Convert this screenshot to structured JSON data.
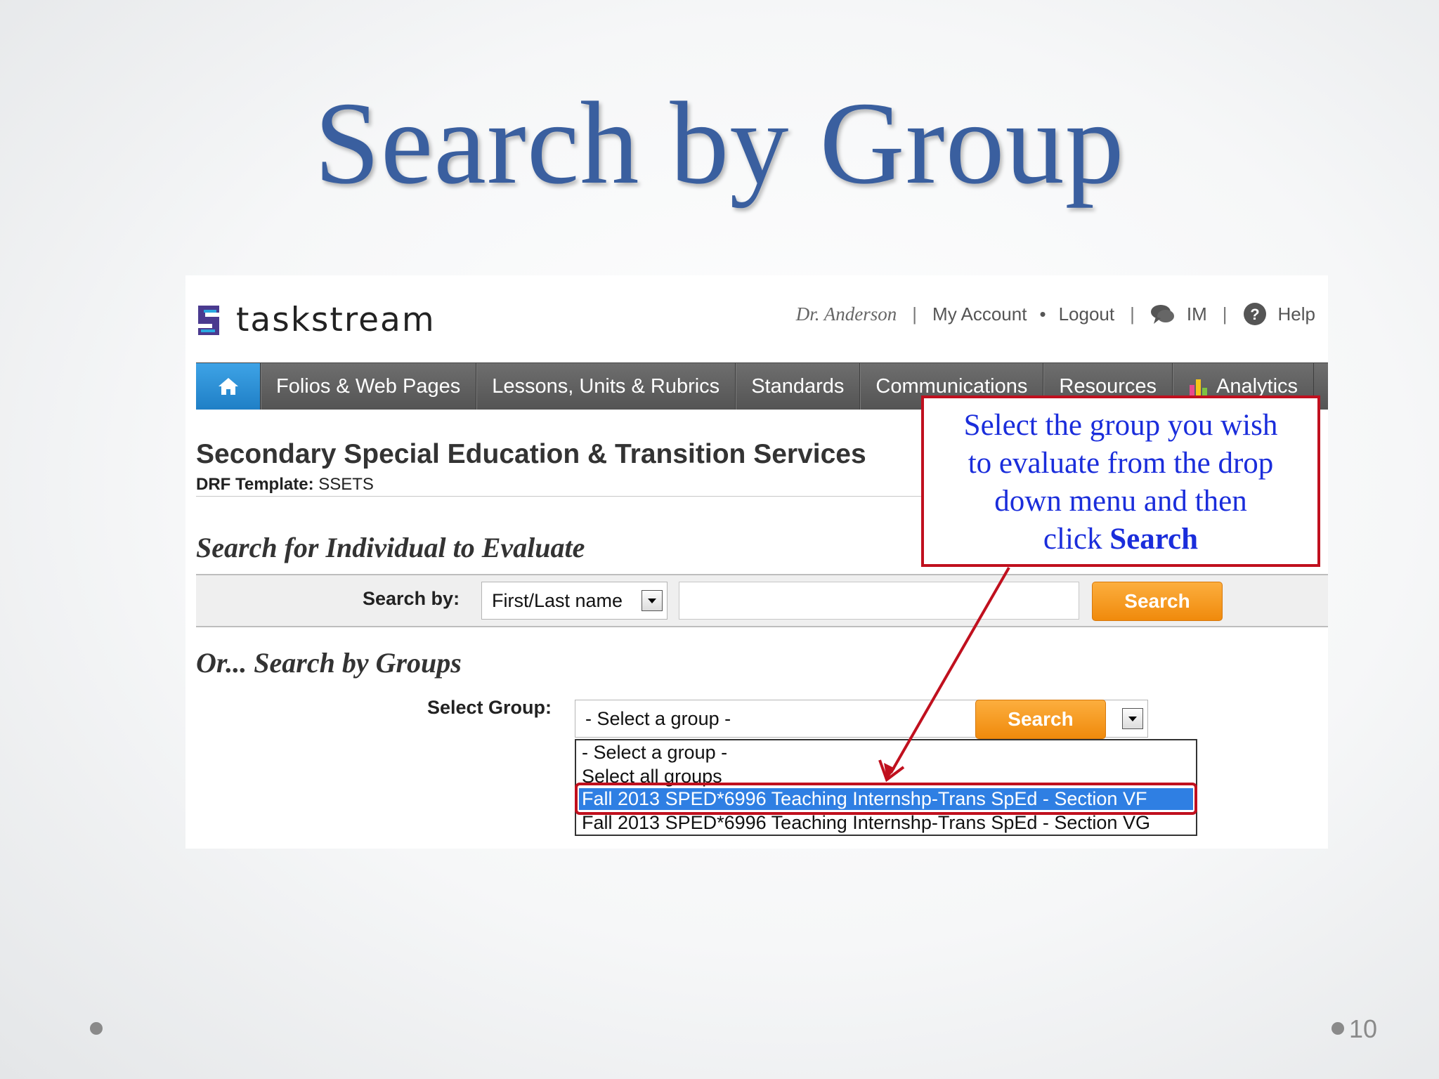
{
  "slide": {
    "title": "Search by Group",
    "page_number": "10",
    "callout": {
      "line1": "Select the group you wish",
      "line2": "to evaluate from the drop",
      "line3": "down menu and then",
      "line4_prefix": "click ",
      "line4_bold": "Search"
    }
  },
  "app": {
    "logo_text": "taskstream",
    "user_name": "Dr. Anderson",
    "links": {
      "account": "My Account",
      "logout": "Logout",
      "im": "IM",
      "help": "Help"
    },
    "nav": {
      "items": [
        "Folios & Web Pages",
        "Lessons, Units & Rubrics",
        "Standards",
        "Communications",
        "Resources",
        "Analytics"
      ]
    },
    "program_title": "Secondary Special Education & Transition Services",
    "drf_label": "DRF Template:",
    "drf_value": "SSETS",
    "individual": {
      "heading": "Search for Individual to Evaluate",
      "search_by_label": "Search by:",
      "search_by_value": "First/Last name",
      "query_value": "",
      "search_button": "Search"
    },
    "groups": {
      "heading": "Or... Search by Groups",
      "select_label": "Select Group:",
      "select_value": "- Select a group -",
      "search_button": "Search",
      "options": [
        "- Select a group -",
        "Select all groups",
        "Fall 2013 SPED*6996 Teaching Internshp-Trans SpEd - Section VF",
        "Fall 2013 SPED*6996 Teaching Internshp-Trans SpEd - Section VG"
      ],
      "highlighted_option_index": 2
    }
  },
  "colors": {
    "title": "#3a5f9f",
    "callout_text": "#1a2ddb",
    "callout_border": "#c0101e",
    "button_orange": "#f08a0c",
    "nav_home": "#1f7fc6",
    "selected_option": "#2f7fe3"
  }
}
